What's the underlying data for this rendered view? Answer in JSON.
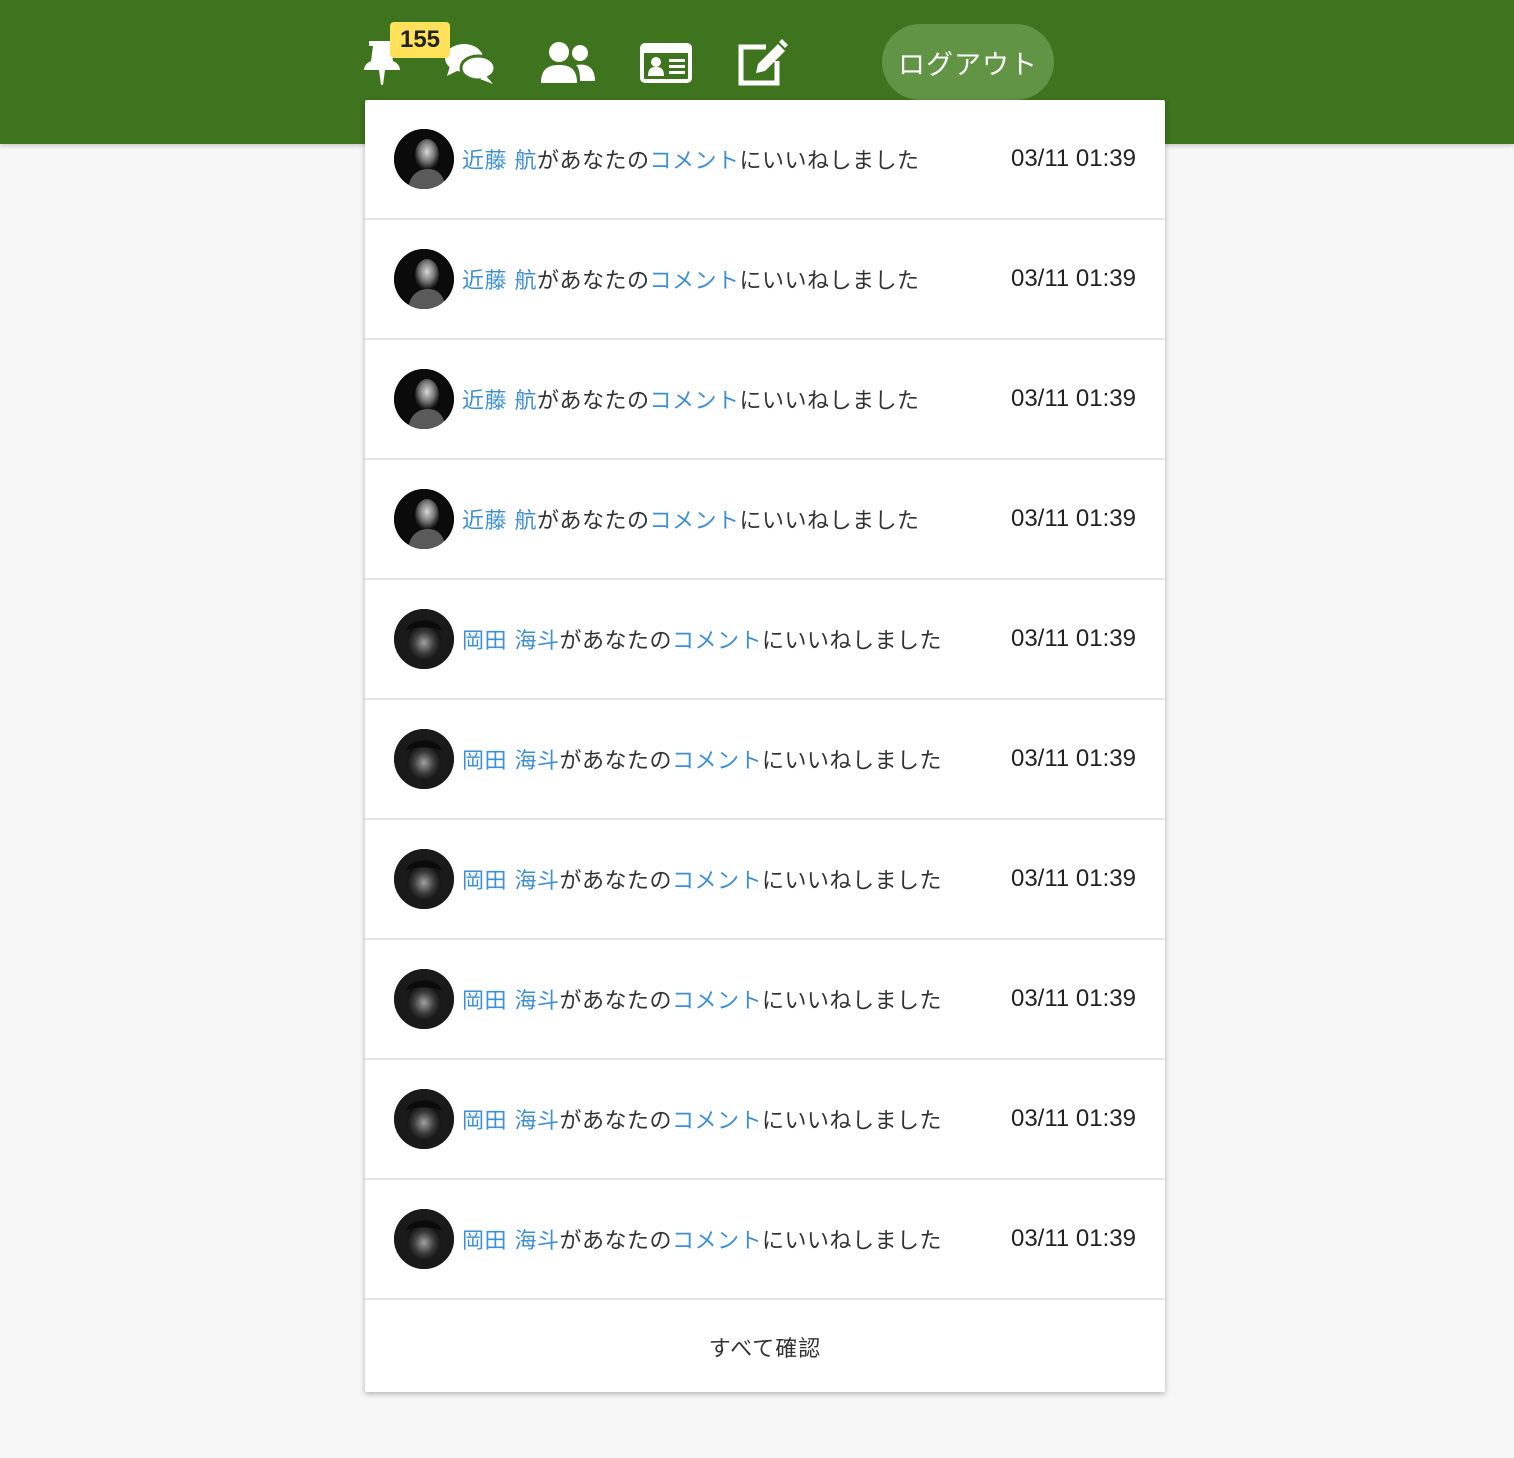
{
  "header": {
    "badge_count": "155",
    "logout_label": "ログアウト",
    "icons": [
      "pin-icon",
      "chat-icon",
      "users-icon",
      "id-card-icon",
      "edit-icon"
    ],
    "bg_color": "#3d741d",
    "badge_color": "#ffe15a"
  },
  "notifications": [
    {
      "name": "近藤 航",
      "pre": "があなたの",
      "target": "コメント",
      "post": "にいいねしました",
      "time": "03/11 01:39",
      "avatar": "avatar-kondo"
    },
    {
      "name": "近藤 航",
      "pre": "があなたの",
      "target": "コメント",
      "post": "にいいねしました",
      "time": "03/11 01:39",
      "avatar": "avatar-kondo"
    },
    {
      "name": "近藤 航",
      "pre": "があなたの",
      "target": "コメント",
      "post": "にいいねしました",
      "time": "03/11 01:39",
      "avatar": "avatar-kondo"
    },
    {
      "name": "近藤 航",
      "pre": "があなたの",
      "target": "コメント",
      "post": "にいいねしました",
      "time": "03/11 01:39",
      "avatar": "avatar-kondo"
    },
    {
      "name": "岡田 海斗",
      "pre": "があなたの",
      "target": "コメント",
      "post": "にいいねしました",
      "time": "03/11 01:39",
      "avatar": "avatar-okada"
    },
    {
      "name": "岡田 海斗",
      "pre": "があなたの",
      "target": "コメント",
      "post": "にいいねしました",
      "time": "03/11 01:39",
      "avatar": "avatar-okada"
    },
    {
      "name": "岡田 海斗",
      "pre": "があなたの",
      "target": "コメント",
      "post": "にいいねしました",
      "time": "03/11 01:39",
      "avatar": "avatar-okada"
    },
    {
      "name": "岡田 海斗",
      "pre": "があなたの",
      "target": "コメント",
      "post": "にいいねしました",
      "time": "03/11 01:39",
      "avatar": "avatar-okada"
    },
    {
      "name": "岡田 海斗",
      "pre": "があなたの",
      "target": "コメント",
      "post": "にいいねしました",
      "time": "03/11 01:39",
      "avatar": "avatar-okada"
    },
    {
      "name": "岡田 海斗",
      "pre": "があなたの",
      "target": "コメント",
      "post": "にいいねしました",
      "time": "03/11 01:39",
      "avatar": "avatar-okada"
    }
  ],
  "footer": {
    "see_all_label": "すべて確認"
  }
}
